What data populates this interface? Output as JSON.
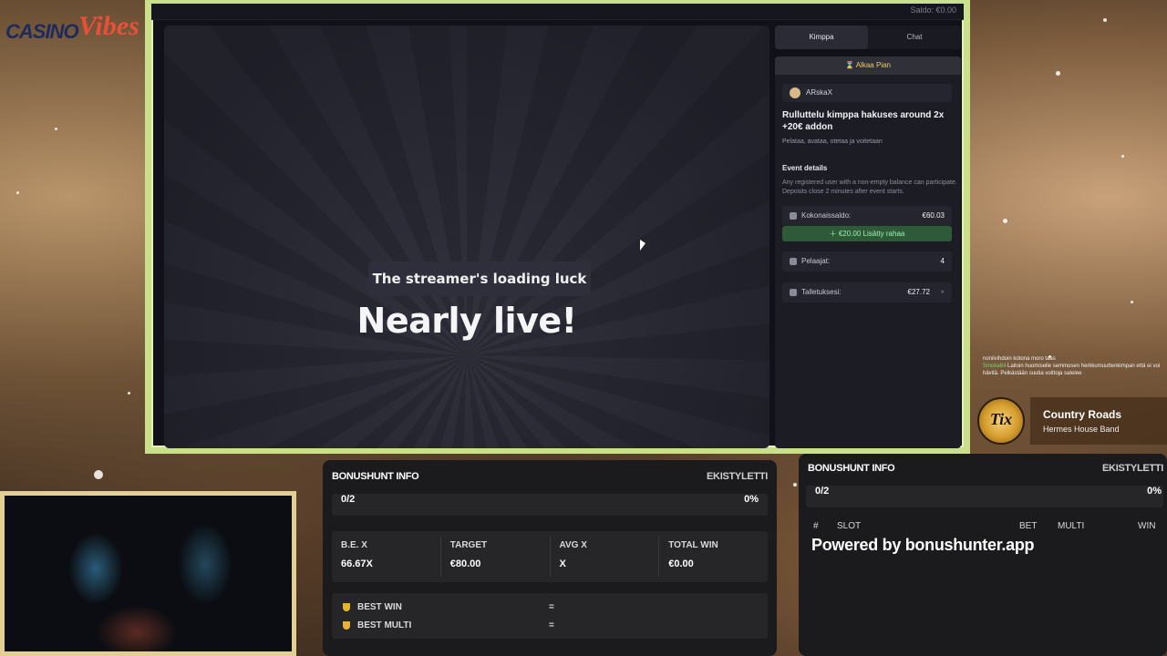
{
  "logo": {
    "part1": "CASINO",
    "part2": "Vibes"
  },
  "stream": {
    "topbar_right": "Saldo: €0.00",
    "loading_text": "The streamer's loading luck",
    "headline": "Nearly live!"
  },
  "sidebar": {
    "tabs": [
      {
        "label": "Kimppa",
        "active": true
      },
      {
        "label": "Chat",
        "active": false
      }
    ],
    "header": "⌛ Alkaa Pian",
    "host_name": "ARskaX",
    "event_title": "Rulluttelu kimppa hakuses around 2x +20€ addon",
    "event_subtitle": "Pelataa, avataa, otetaa ja voitetaan",
    "details_title": "Event details",
    "details_desc": "Any registered user with a non-empty balance can participate. Deposits close 2 minutes after event starts.",
    "total_label": "Kokonaissaldo:",
    "total_value": "€60.03",
    "addon_label": "＋ €20.00 Lisätty rahaa",
    "players_label": "Pelaajat:",
    "players_value": "4",
    "deposit_label": "Talletuksesi:",
    "deposit_value": "€27.72",
    "deposit_remove": "×"
  },
  "chat_overlay": [
    {
      "user": "",
      "text": "noniivihdoin kotona moro taas"
    },
    {
      "user": "Smoka84",
      "text": "Laitoin huomiselle semmosen herkkumuuttenkimpan että ei voi hävitä. Pelkästään suutia voittoja satelee"
    }
  ],
  "now_playing": {
    "badge": "Tix",
    "title": "Country Roads",
    "artist": "Hermes House Band"
  },
  "bonushunt_left": {
    "title": "BONUSHUNT INFO",
    "streamer": "EKISTYLETTI",
    "progress": "0/2",
    "percent": "0%",
    "metrics": [
      {
        "label": "B.E. X",
        "value": "66.67X"
      },
      {
        "label": "TARGET",
        "value": "€80.00"
      },
      {
        "label": "AVG X",
        "value": "X"
      },
      {
        "label": "TOTAL WIN",
        "value": "€0.00"
      }
    ],
    "best_win_label": "BEST WIN",
    "best_win_value": "=",
    "best_multi_label": "BEST MULTI",
    "best_multi_value": "="
  },
  "bonushunt_right": {
    "title": "BONUSHUNT INFO",
    "streamer": "EKISTYLETTI",
    "progress": "0/2",
    "percent": "0%",
    "columns": {
      "num": "#",
      "slot": "SLOT",
      "bet": "BET",
      "multi": "MULTI",
      "win": "WIN"
    },
    "powered": "Powered by bonushunter.app"
  },
  "colors": {
    "frame_border": "#c9df8a",
    "accent_green": "#2f5a3a",
    "gold": "#f1c862"
  }
}
